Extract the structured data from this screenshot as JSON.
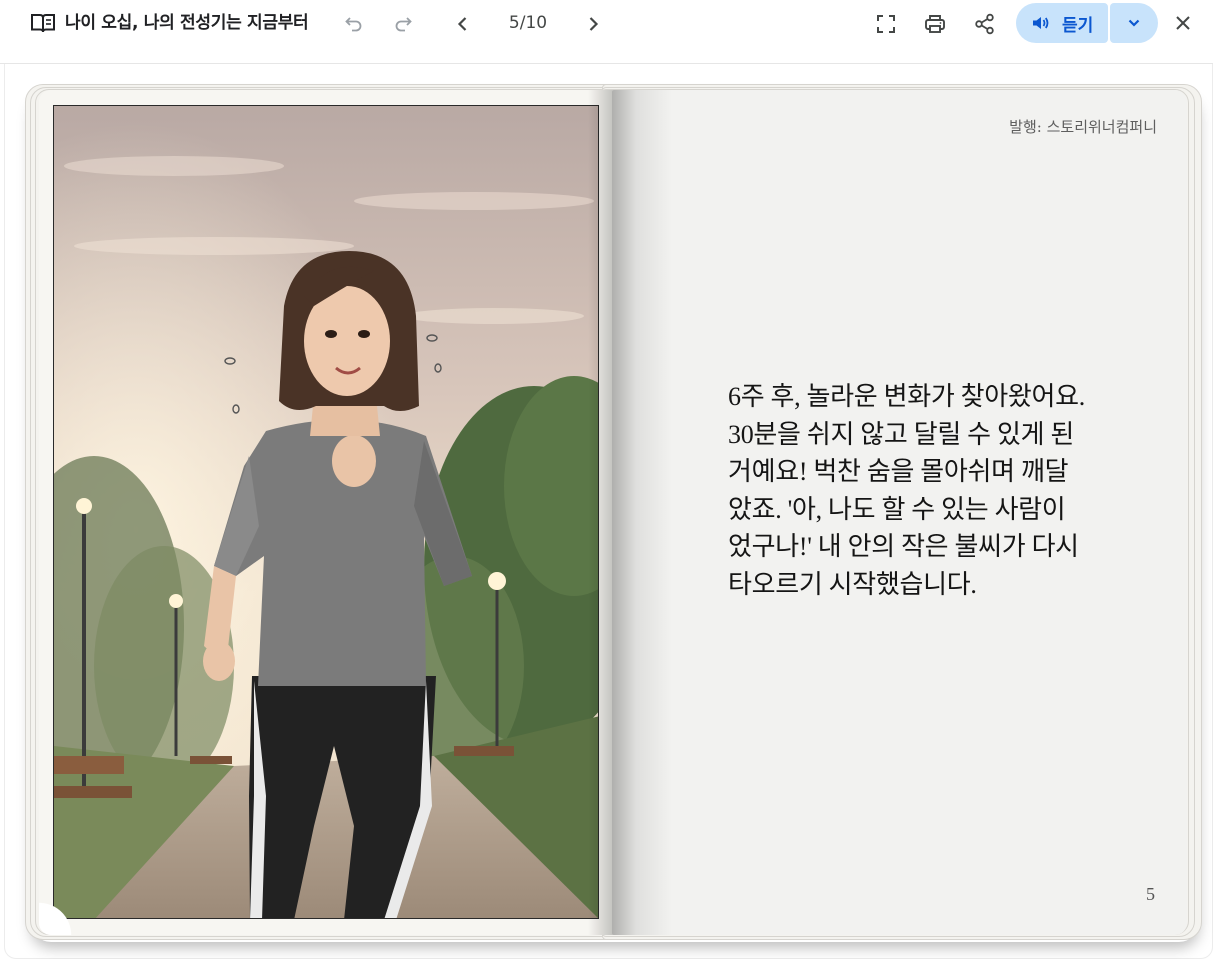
{
  "toolbar": {
    "title": "나이 오십, 나의 전성기는 지금부터",
    "page_indicator": "5/10",
    "listen_label": "듣기",
    "icons": {
      "book": "book-open-icon",
      "undo": "undo-icon",
      "redo": "redo-icon",
      "prev": "chevron-left-icon",
      "next": "chevron-right-icon",
      "fullscreen": "fullscreen-icon",
      "print": "print-icon",
      "share": "share-icon",
      "listen": "speaker-icon",
      "dropdown": "chevron-down-icon",
      "close": "close-icon"
    }
  },
  "book": {
    "right_page": {
      "publisher": "발행: 스토리위너컴퍼니",
      "text": "6주 후, 놀라운 변화가 찾아왔어요. 30분을 쉬지 않고 달릴 수 있게 된 거예요! 벅찬 숨을 몰아쉬며 깨달았죠. '아, 나도 할 수 있는 사람이었구나!' 내 안의 작은 불씨가 다시 타오르기 시작했습니다.",
      "page_number": "5"
    }
  },
  "colors": {
    "accent": "#0b57d0",
    "listen_bg": "#c8e3fb",
    "page_bg": "#f2f2f0"
  }
}
